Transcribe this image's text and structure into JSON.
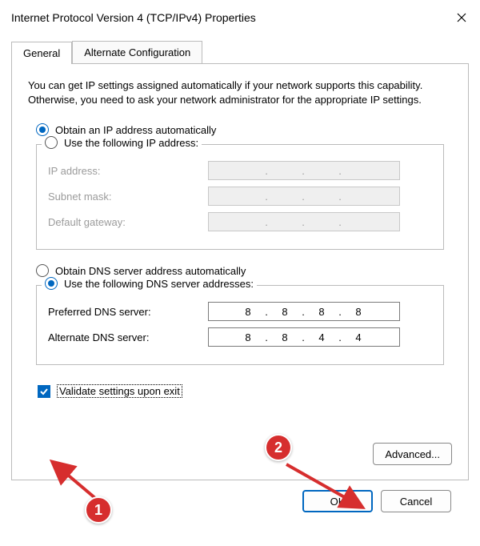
{
  "window": {
    "title": "Internet Protocol Version 4 (TCP/IPv4) Properties"
  },
  "tabs": {
    "general": "General",
    "alternate": "Alternate Configuration"
  },
  "intro": "You can get IP settings assigned automatically if your network supports this capability. Otherwise, you need to ask your network administrator for the appropriate IP settings.",
  "ip_section": {
    "auto_label": "Obtain an IP address automatically",
    "manual_label": "Use the following IP address:",
    "ip_label": "IP address:",
    "mask_label": "Subnet mask:",
    "gateway_label": "Default gateway:",
    "ip_value": [
      "",
      "",
      "",
      ""
    ],
    "mask_value": [
      "",
      "",
      "",
      ""
    ],
    "gateway_value": [
      "",
      "",
      "",
      ""
    ],
    "selected": "auto"
  },
  "dns_section": {
    "auto_label": "Obtain DNS server address automatically",
    "manual_label": "Use the following DNS server addresses:",
    "preferred_label": "Preferred DNS server:",
    "alternate_label": "Alternate DNS server:",
    "preferred_value": [
      "8",
      "8",
      "8",
      "8"
    ],
    "alternate_value": [
      "8",
      "8",
      "4",
      "4"
    ],
    "selected": "manual"
  },
  "validate_label": "Validate settings upon exit",
  "validate_checked": true,
  "advanced_label": "Advanced...",
  "ok_label": "OK",
  "cancel_label": "Cancel",
  "annotations": {
    "badge1": "1",
    "badge2": "2"
  }
}
